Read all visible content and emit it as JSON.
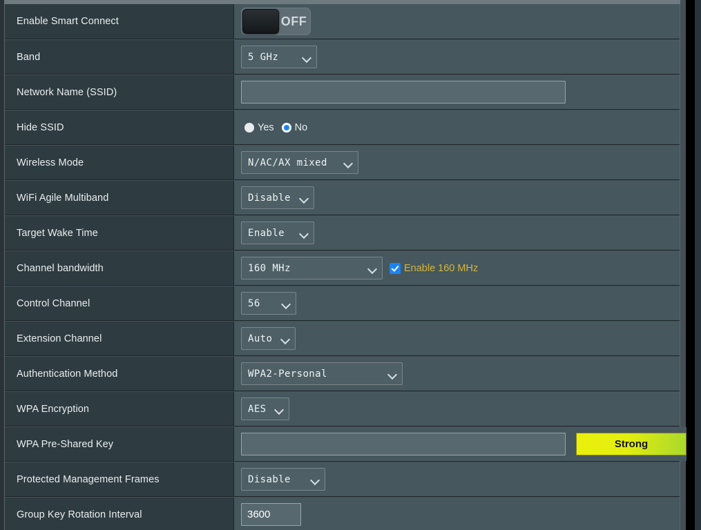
{
  "rows": [
    {
      "label": "Enable Smart Connect",
      "control": "toggle",
      "toggle_state": "OFF"
    },
    {
      "label": "Band",
      "control": "select",
      "value": "5 GHz"
    },
    {
      "label": "Network Name (SSID)",
      "control": "text",
      "value": "",
      "placeholder": ""
    },
    {
      "label": "Hide SSID",
      "control": "radio",
      "options": [
        "Yes",
        "No"
      ],
      "selected": "No"
    },
    {
      "label": "Wireless Mode",
      "control": "select",
      "value": "N/AC/AX mixed"
    },
    {
      "label": "WiFi Agile Multiband",
      "control": "select",
      "value": "Disable"
    },
    {
      "label": "Target Wake Time",
      "control": "select",
      "value": "Enable"
    },
    {
      "label": "Channel bandwidth",
      "control": "select-checkbox",
      "value": "160 MHz",
      "checkbox_label": "Enable 160 MHz",
      "checkbox_checked": true
    },
    {
      "label": "Control Channel",
      "control": "select",
      "value": "56"
    },
    {
      "label": "Extension Channel",
      "control": "select",
      "value": "Auto"
    },
    {
      "label": "Authentication Method",
      "control": "select",
      "value": "WPA2-Personal"
    },
    {
      "label": "WPA Encryption",
      "control": "select",
      "value": "AES"
    },
    {
      "label": "WPA Pre-Shared Key",
      "control": "text-badge",
      "value": "",
      "badge_label": "Strong"
    },
    {
      "label": "Protected Management Frames",
      "control": "select",
      "value": "Disable"
    },
    {
      "label": "Group Key Rotation Interval",
      "control": "text",
      "value": "3600"
    }
  ],
  "colors": {
    "label_column_bg": "#2e3b41",
    "value_column_bg": "#46575e",
    "accent_blue": "#1b84f5",
    "accent_yellow_text": "#d6b538",
    "badge_start": "#eaf00c",
    "badge_end": "#a8d82c"
  }
}
